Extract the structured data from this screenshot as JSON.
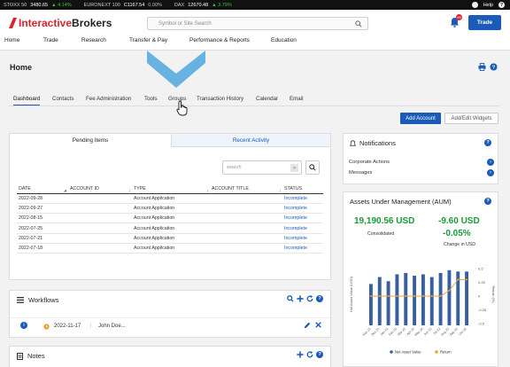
{
  "ticker": [
    {
      "name": "STOXX 50",
      "value": "3480.65",
      "change": "▲ 4.14%",
      "dir": "up"
    },
    {
      "name": "EURONEXT 100",
      "value": "C1167.54",
      "change": "0.00%",
      "dir": "flat"
    },
    {
      "name": "DAX",
      "value": "12670.48",
      "change": "▲ 3.79%",
      "dir": "up"
    }
  ],
  "topright": {
    "help_label": "Help"
  },
  "brand": {
    "part1": "Interactive",
    "part2": "Brokers"
  },
  "search": {
    "placeholder": "Symbol or Site Search"
  },
  "notifications_badge": "99",
  "trade_button": "Trade",
  "main_nav": [
    "Home",
    "Trade",
    "Research",
    "Transfer & Pay",
    "Performance & Reports",
    "Education"
  ],
  "page": {
    "title": "Home"
  },
  "sub_tabs": [
    "Dashboard",
    "Contacts",
    "Fee Administration",
    "Tools",
    "Groups",
    "Transaction History",
    "Calendar",
    "Email"
  ],
  "buttons": {
    "add_account": "Add Account",
    "edit_widgets": "Add/Edit Widgets"
  },
  "pending": {
    "tab_active": "Pending Items",
    "tab_other": "Recent Activity",
    "search_placeholder": "search",
    "columns": [
      "DATE",
      "ACCOUNT ID",
      "TYPE",
      "ACCOUNT TITLE",
      "STATUS"
    ],
    "rows": [
      {
        "date": "2022-09-28",
        "id": "",
        "type": "Account Application",
        "title": "",
        "status": "Incomplete"
      },
      {
        "date": "2022-09-27",
        "id": "",
        "type": "Account Application",
        "title": "",
        "status": "Incomplete"
      },
      {
        "date": "2022-08-15",
        "id": "",
        "type": "Account Application",
        "title": "",
        "status": "Incomplete"
      },
      {
        "date": "2022-07-25",
        "id": "",
        "type": "Account Application",
        "title": "",
        "status": "Incomplete"
      },
      {
        "date": "2022-07-21",
        "id": "",
        "type": "Account Application",
        "title": "",
        "status": "Incomplete"
      },
      {
        "date": "2022-07-18",
        "id": "",
        "type": "Account Application",
        "title": "",
        "status": "Incomplete"
      }
    ]
  },
  "workflows": {
    "title": "Workflows",
    "item": {
      "date": "2022-11-17",
      "separator": "|",
      "user": "John Doe..."
    }
  },
  "notes": {
    "title": "Notes"
  },
  "notifications": {
    "title": "Notifications",
    "items": [
      "Corporate Actions",
      "Messages"
    ]
  },
  "aum": {
    "title": "Assets Under Management (AUM)",
    "consolidated_value": "19,190.56 USD",
    "consolidated_label": "Consolidated",
    "change_value": "-9.60 USD",
    "change_pct": "-0.05%",
    "change_label": "Change in USD"
  },
  "chart_data": {
    "type": "bar",
    "categories": [
      "Nov 21",
      "Dec 21",
      "Jan 22",
      "Feb 22",
      "Mar 22",
      "Apr 22",
      "May 22",
      "Jun 22",
      "Jul 22",
      "Aug 22",
      "Sep 22",
      "Oct 22"
    ],
    "series": [
      {
        "name": "Net Asset Value",
        "values": [
          19100,
          19150,
          19120,
          19170,
          19180,
          19160,
          19170,
          19150,
          19180,
          19200,
          19190,
          19190
        ],
        "color": "#3a5fa0"
      },
      {
        "name": "Return",
        "values": [
          0.0,
          0.0,
          0.0,
          0.0,
          0.0,
          0.0,
          0.0,
          0.0,
          0.0,
          0.1,
          0.3,
          0.3
        ],
        "color": "#f0a030"
      }
    ],
    "ylabel": "Net Asset Value (USD)",
    "y2label": "Return (%)",
    "y2_ticks": [
      "0.5",
      "0.25",
      "0",
      "-0.25",
      "-0.5"
    ],
    "legend": "bottom"
  },
  "colors": {
    "accent": "#1a5bb8",
    "brand_red": "#d8262d",
    "positive": "#1a9a3a"
  }
}
